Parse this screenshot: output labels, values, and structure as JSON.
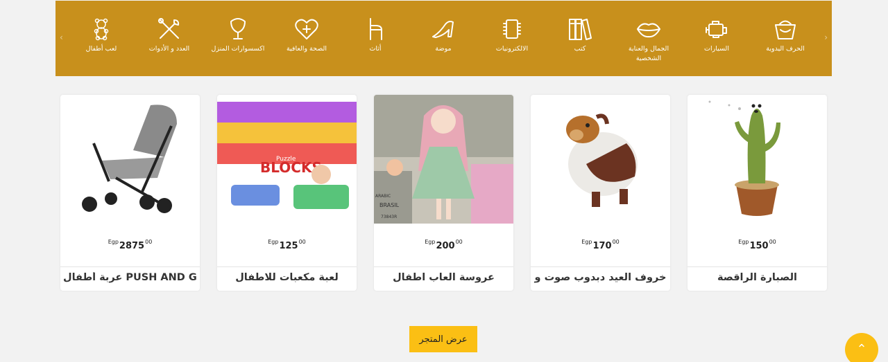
{
  "categories": [
    {
      "label": "الحرف اليدوية",
      "icon": "basket-icon"
    },
    {
      "label": "السيارات",
      "icon": "engine-icon"
    },
    {
      "label": "الجمال والعناية الشخصية",
      "icon": "lips-icon"
    },
    {
      "label": "كتب",
      "icon": "books-icon"
    },
    {
      "label": "الالكترونيات",
      "icon": "chip-icon"
    },
    {
      "label": "موضة",
      "icon": "heel-shoe-icon"
    },
    {
      "label": "أثاث",
      "icon": "chair-icon"
    },
    {
      "label": "الصحة والعافية",
      "icon": "heart-plus-icon"
    },
    {
      "label": "اكسسوارات المنزل",
      "icon": "lamp-icon"
    },
    {
      "label": "العدد و الأدوات",
      "icon": "tools-icon"
    },
    {
      "label": "لعب أطفال",
      "icon": "teddy-bear-icon"
    }
  ],
  "nav": {
    "prev": "‹",
    "next": "›"
  },
  "products": [
    {
      "name": "الصبارة الراقصة",
      "currency": "Egp",
      "price": "150",
      "decimals": "00",
      "image": "dancing-cactus-toy-image"
    },
    {
      "name": "خروف العيد دبدوب صوت و",
      "currency": "Egp",
      "price": "170",
      "decimals": "00",
      "image": "sheep-plush-toy-image"
    },
    {
      "name": "عروسة العاب اطفال",
      "currency": "Egp",
      "price": "200",
      "decimals": "00",
      "image": "doll-image"
    },
    {
      "name": "لعبة مكعبات للاطفال",
      "currency": "Egp",
      "price": "125",
      "decimals": "00",
      "image": "building-blocks-image"
    },
    {
      "name": "عربة أطفال PUSH AND GO",
      "currency": "Egp",
      "price": "2875",
      "decimals": "00",
      "image": "baby-stroller-image"
    }
  ],
  "doll_box_text": {
    "brand": "BRASIL",
    "barcode": "73843R",
    "side": "ARABIC"
  },
  "blocks_box_text": {
    "line1": "Puzzle",
    "line2": "BLOCKS"
  },
  "store_button": "عرض المتجر",
  "scroll_top": "⌃",
  "colors": {
    "category_bar": "#c8901c",
    "accent": "#fbbf14"
  }
}
